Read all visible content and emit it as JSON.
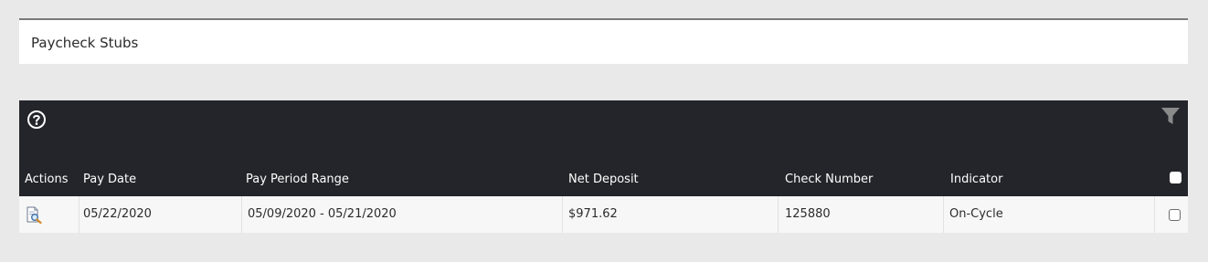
{
  "panel": {
    "title": "Paycheck Stubs"
  },
  "grid": {
    "toolbar": {
      "help_icon": "question-circle-icon",
      "filter_icon": "funnel-filter-icon"
    },
    "columns": [
      "Actions",
      "Pay Date",
      "Pay Period Range",
      "Net Deposit",
      "Check Number",
      "Indicator"
    ],
    "header_checkbox_checked": false,
    "rows": [
      {
        "action_icon": "view-document-icon",
        "pay_date": "05/22/2020",
        "pay_period_range": "05/09/2020 - 05/21/2020",
        "net_deposit": "$971.62",
        "check_number": "125880",
        "indicator": "On-Cycle",
        "selected": false
      }
    ]
  },
  "colors": {
    "page_background": "#e9e9e9",
    "header_background": "#23252a",
    "row_background": "#f7f7f7",
    "header_text": "#ffffff",
    "body_text": "#2b2b2b"
  }
}
